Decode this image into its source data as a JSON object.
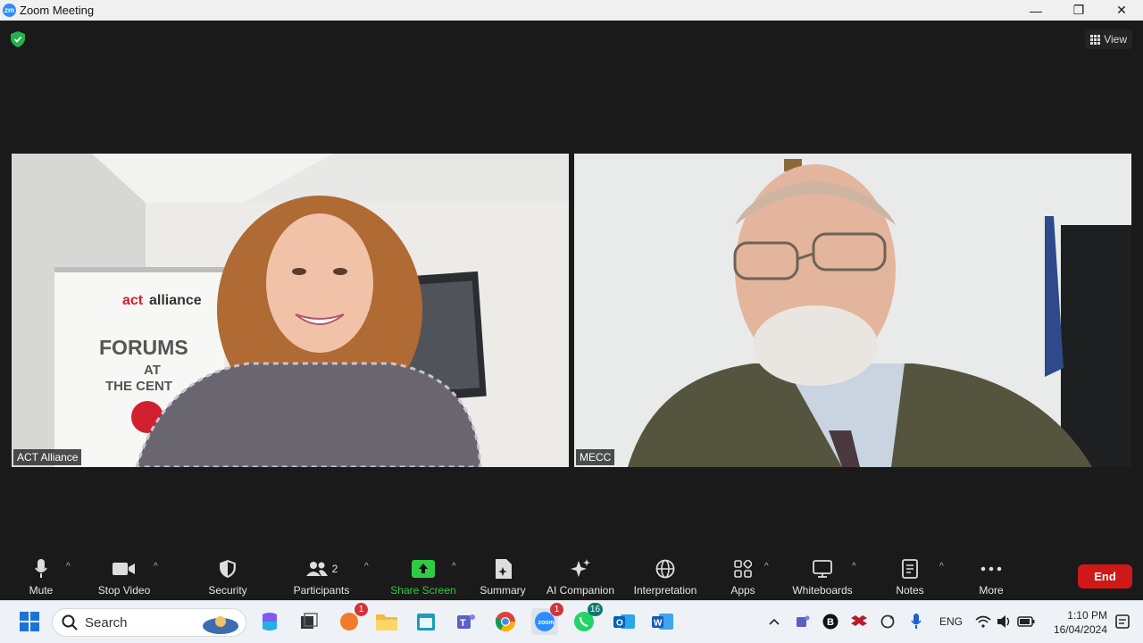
{
  "window": {
    "title": "Zoom Meeting",
    "app_icon_text": "zm",
    "minimize": "—",
    "maximize": "❐",
    "close": "✕"
  },
  "meeting": {
    "view_label": "View",
    "participants": [
      {
        "name": "ACT Alliance"
      },
      {
        "name": "MECC"
      }
    ],
    "banner": {
      "logo_act": "act",
      "logo_alliance": "alliance",
      "line1": "FORUMS",
      "line2": "AT",
      "line3": "THE CENT"
    }
  },
  "toolbar": {
    "mute": "Mute",
    "stop_video": "Stop Video",
    "security": "Security",
    "participants": "Participants",
    "participants_count": "2",
    "share_screen": "Share Screen",
    "summary": "Summary",
    "ai_companion": "AI Companion",
    "interpretation": "Interpretation",
    "apps": "Apps",
    "whiteboards": "Whiteboards",
    "notes": "Notes",
    "more": "More",
    "end": "End"
  },
  "taskbar": {
    "search_placeholder": "Search",
    "badges": {
      "office": "1",
      "zoom": "1",
      "whatsapp": "16"
    },
    "tray": {
      "language": "ENG",
      "time": "1:10 PM",
      "date": "16/04/2024"
    }
  },
  "colors": {
    "background": "#1a1a1a",
    "share_green": "#2ecc40",
    "end_red": "#d01818",
    "shield_green": "#23b14d"
  }
}
